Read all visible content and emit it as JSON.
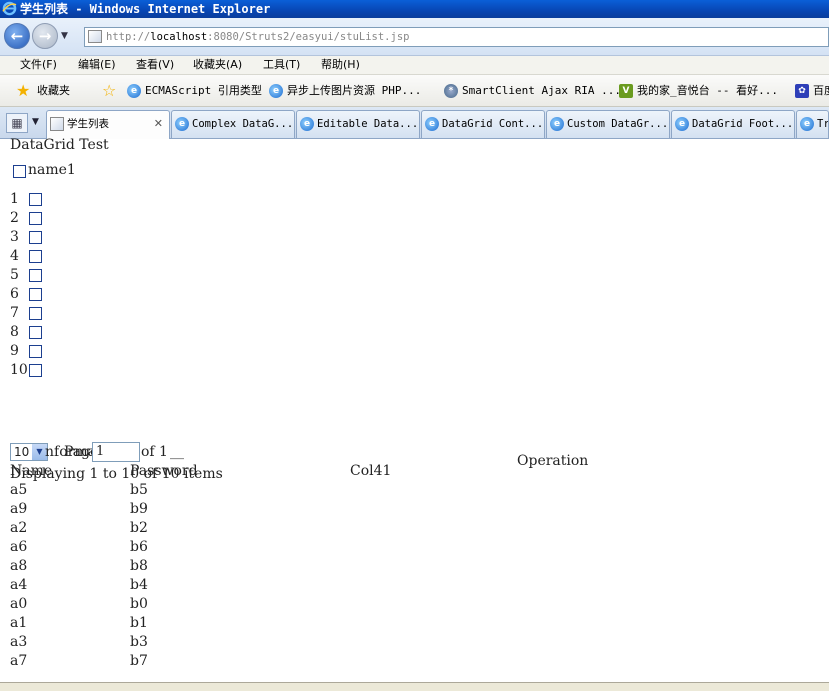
{
  "window": {
    "title": "学生列表 - Windows Internet Explorer"
  },
  "navigation": {
    "url_prefix": "http://",
    "url_host": "localhost",
    "url_rest": ":8080/Struts2/easyui/stuList.jsp"
  },
  "menu": [
    "文件(F)",
    "编辑(E)",
    "查看(V)",
    "收藏夹(A)",
    "工具(T)",
    "帮助(H)"
  ],
  "favorites": {
    "label": "收藏夹",
    "items": [
      "ECMAScript 引用类型",
      "异步上传图片资源  PHP...",
      "SmartClient Ajax RIA ...",
      "我的家_音悦台 -- 看好...",
      "百度"
    ]
  },
  "tabs": [
    {
      "label": "学生列表",
      "close": "✕"
    },
    {
      "label": "Complex DataG..."
    },
    {
      "label": "Editable Data..."
    },
    {
      "label": "DataGrid Cont..."
    },
    {
      "label": "Custom DataGr..."
    },
    {
      "label": "DataGrid Foot..."
    },
    {
      "label": "Tr"
    }
  ],
  "page": {
    "title": "DataGrid Test",
    "header_checkbox_label": "name1",
    "row_numbers": [
      "1",
      "2",
      "3",
      "4",
      "5",
      "6",
      "7",
      "8",
      "9",
      "10"
    ],
    "pager": {
      "page_size": "10",
      "page_label": "Page",
      "page_value": "1",
      "of_label": "of 1",
      "refresh_glyph": "__",
      "info_overlap": "nforma",
      "display_text": "Displaying 1 to 10 of 10 items"
    },
    "columns": [
      "Name",
      "Password",
      "Col41",
      "Operation"
    ],
    "rows": [
      {
        "name": "a5",
        "password": "b5"
      },
      {
        "name": "a9",
        "password": "b9"
      },
      {
        "name": "a2",
        "password": "b2"
      },
      {
        "name": "a6",
        "password": "b6"
      },
      {
        "name": "a8",
        "password": "b8"
      },
      {
        "name": "a4",
        "password": "b4"
      },
      {
        "name": "a0",
        "password": "b0"
      },
      {
        "name": "a1",
        "password": "b1"
      },
      {
        "name": "a3",
        "password": "b3"
      },
      {
        "name": "a7",
        "password": "b7"
      }
    ]
  }
}
